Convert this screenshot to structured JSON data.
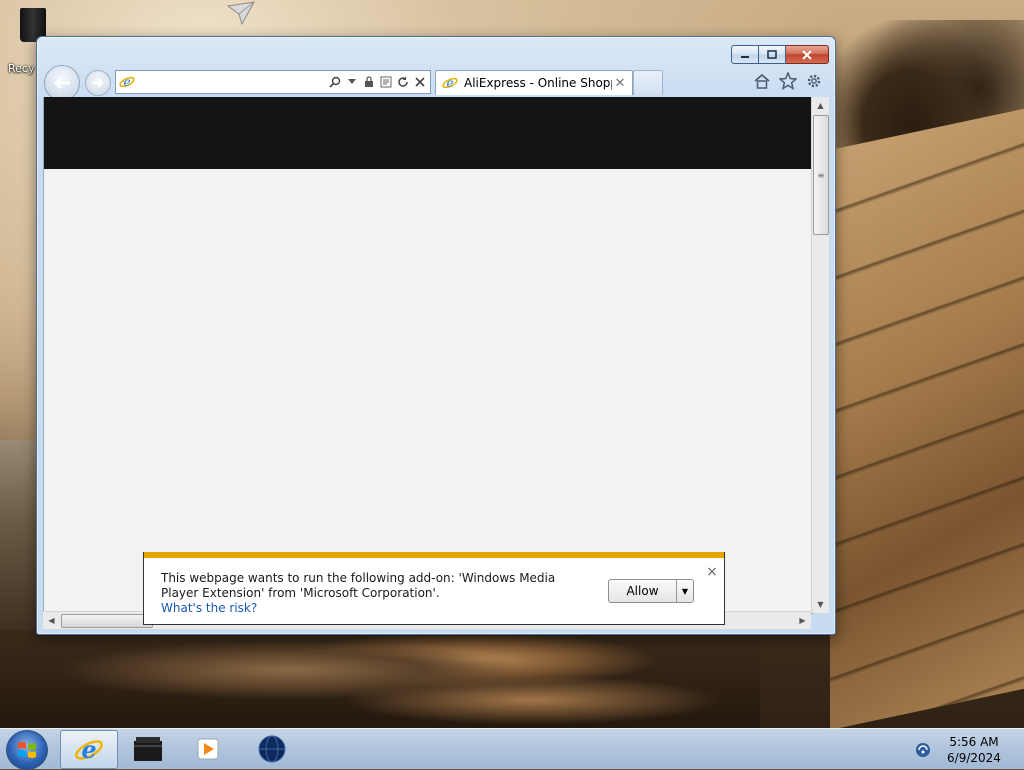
{
  "desktop": {
    "recycle_bin_label": "Recy"
  },
  "browser": {
    "address_value": "",
    "tab_title": "AliExpress - Online Shoppi...",
    "tab_close_glyph": "✕",
    "icons": {
      "back": "back-arrow-icon",
      "forward": "forward-arrow-icon",
      "search": "search-icon",
      "lock": "lock-icon",
      "compat": "compatibility-view-icon",
      "refresh": "refresh-icon",
      "stop": "stop-icon",
      "home": "home-icon",
      "favorites": "star-icon",
      "tools": "gear-icon"
    },
    "page_header_color": "#141414",
    "page_background_color": "#f2f2f2"
  },
  "notification": {
    "message": "This webpage wants to run the following add-on: 'Windows Media Player Extension' from 'Microsoft Corporation'.",
    "risk_link": "What's the risk?",
    "allow_label": "Allow",
    "close_glyph": "×",
    "accent_color": "#e5a400"
  },
  "taskbar": {
    "time": "5:56 AM",
    "date": "6/9/2024",
    "items": [
      "internet-explorer",
      "file-explorer",
      "media-player",
      "network-globe"
    ]
  }
}
